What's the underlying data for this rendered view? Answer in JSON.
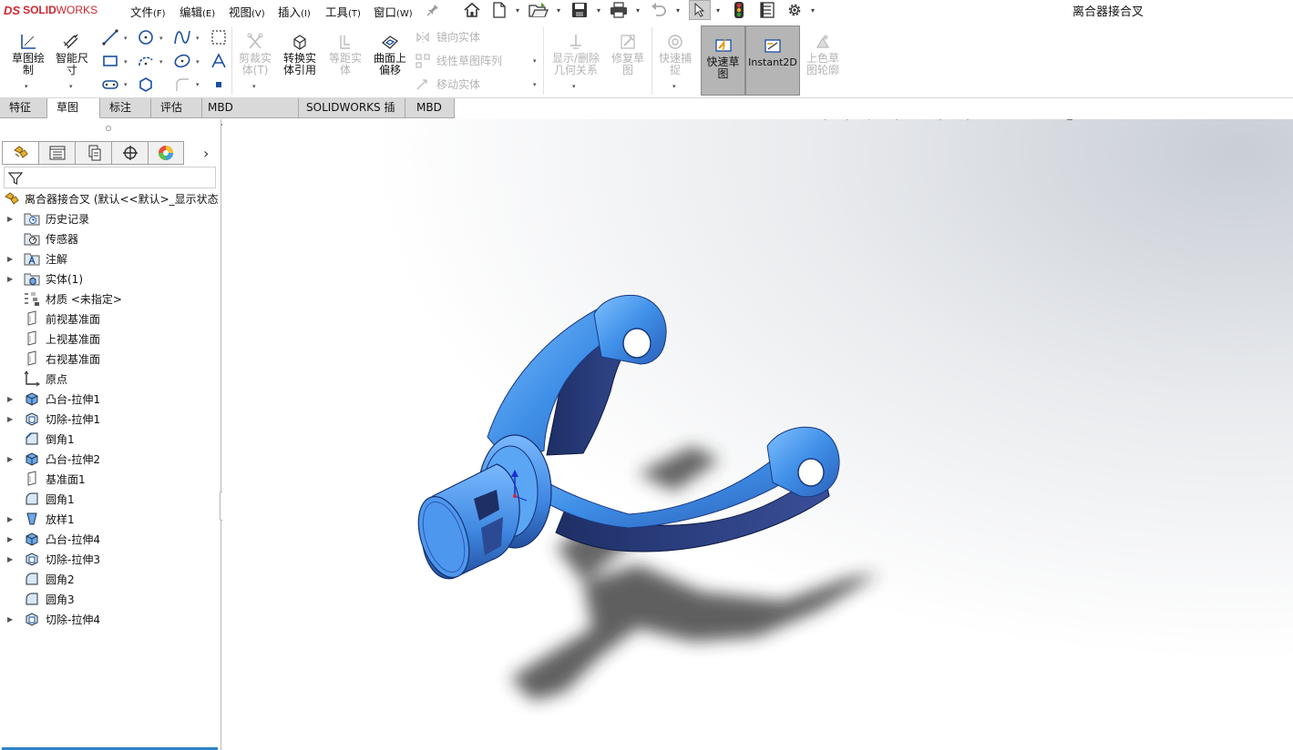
{
  "app": {
    "logo_ds": "DS",
    "logo_solid": "SOLID",
    "logo_works": "WORKS",
    "document_title": "离合器接合叉"
  },
  "menu": [
    {
      "label": "文件",
      "key": "(F)"
    },
    {
      "label": "编辑",
      "key": "(E)"
    },
    {
      "label": "视图",
      "key": "(V)"
    },
    {
      "label": "插入",
      "key": "(I)"
    },
    {
      "label": "工具",
      "key": "(T)"
    },
    {
      "label": "窗口",
      "key": "(W)"
    }
  ],
  "quick_access_icons": [
    "pin-icon",
    "home-icon",
    "new-document-icon",
    "open-icon",
    "save-icon",
    "print-icon",
    "undo-icon",
    "select-arrow-icon",
    "rebuild-traffic-light-icon",
    "file-properties-icon",
    "options-gear-icon"
  ],
  "command_manager": {
    "sketch": {
      "line1": "草图绘",
      "line2": "制"
    },
    "smart_dim": {
      "line1": "智能尺",
      "line2": "寸"
    },
    "trim": {
      "line1": "剪裁实",
      "line2": "体(T)"
    },
    "convert": {
      "line1": "转换实",
      "line2": "体引用"
    },
    "offset": {
      "line1": "等距实",
      "line2": "体"
    },
    "offset_surface": {
      "line1": "曲面上",
      "line2": "偏移"
    },
    "mirror": "镜向实体",
    "linear_pattern": "线性草图阵列",
    "move": "移动实体",
    "show_relations": {
      "line1": "显示/删除",
      "line2": "几何关系"
    },
    "repair": {
      "line1": "修复草",
      "line2": "图"
    },
    "quick_snap": {
      "line1": "快速捕",
      "line2": "捉"
    },
    "rapid_sketch": {
      "line1": "快速草",
      "line2": "图"
    },
    "instant2d": "Instant2D",
    "shaded_contours": {
      "line1": "上色草",
      "line2": "图轮廓"
    }
  },
  "tabs": [
    {
      "label": "特征",
      "active": false
    },
    {
      "label": "草图",
      "active": true
    },
    {
      "label": "标注",
      "active": false
    },
    {
      "label": "评估",
      "active": false
    },
    {
      "label": "MBD Dimensions",
      "active": false
    },
    {
      "label": "SOLIDWORKS 插件",
      "active": false
    },
    {
      "label": "MBD",
      "active": false
    }
  ],
  "panel_tabs": [
    "feature-manager-icon",
    "property-manager-icon",
    "configuration-manager-icon",
    "dimxpert-icon",
    "display-manager-icon"
  ],
  "tree": {
    "root": "离合器接合叉  (默认<<默认>_显示状态",
    "items": [
      {
        "label": "历史记录",
        "expandable": true,
        "icon": "history-folder-icon"
      },
      {
        "label": "传感器",
        "expandable": false,
        "icon": "sensor-folder-icon"
      },
      {
        "label": "注解",
        "expandable": true,
        "icon": "annotation-folder-icon"
      },
      {
        "label": "实体(1)",
        "expandable": true,
        "icon": "solid-bodies-folder-icon"
      },
      {
        "label": "材质 <未指定>",
        "expandable": false,
        "icon": "material-icon"
      },
      {
        "label": "前视基准面",
        "expandable": false,
        "icon": "plane-icon"
      },
      {
        "label": "上视基准面",
        "expandable": false,
        "icon": "plane-icon"
      },
      {
        "label": "右视基准面",
        "expandable": false,
        "icon": "plane-icon"
      },
      {
        "label": "原点",
        "expandable": false,
        "icon": "origin-icon"
      },
      {
        "label": "凸台-拉伸1",
        "expandable": true,
        "icon": "boss-extrude-icon"
      },
      {
        "label": "切除-拉伸1",
        "expandable": true,
        "icon": "cut-extrude-icon"
      },
      {
        "label": "倒角1",
        "expandable": false,
        "icon": "chamfer-icon"
      },
      {
        "label": "凸台-拉伸2",
        "expandable": true,
        "icon": "boss-extrude-icon"
      },
      {
        "label": "基准面1",
        "expandable": false,
        "icon": "plane-icon"
      },
      {
        "label": "圆角1",
        "expandable": false,
        "icon": "fillet-icon"
      },
      {
        "label": "放样1",
        "expandable": true,
        "icon": "loft-icon"
      },
      {
        "label": "凸台-拉伸4",
        "expandable": true,
        "icon": "boss-extrude-icon"
      },
      {
        "label": "切除-拉伸3",
        "expandable": true,
        "icon": "cut-extrude-icon"
      },
      {
        "label": "圆角2",
        "expandable": false,
        "icon": "fillet-icon"
      },
      {
        "label": "圆角3",
        "expandable": false,
        "icon": "fillet-icon"
      },
      {
        "label": "切除-拉伸4",
        "expandable": true,
        "icon": "cut-extrude-icon"
      }
    ]
  },
  "hud_icons": [
    "zoom-to-fit-icon",
    "zoom-area-icon",
    "previous-view-icon",
    "section-view-icon",
    "dynamic-annotation-icon",
    "view-orientation-icon",
    "display-style-icon",
    "hide-show-icon",
    "edit-appearance-icon",
    "apply-scene-icon",
    "view-settings-icon"
  ],
  "colors": {
    "part_blue": "#3f8fe8",
    "part_dark": "#263a78",
    "accent_red": "#d22630",
    "rollback_bar": "#2f84c8"
  }
}
